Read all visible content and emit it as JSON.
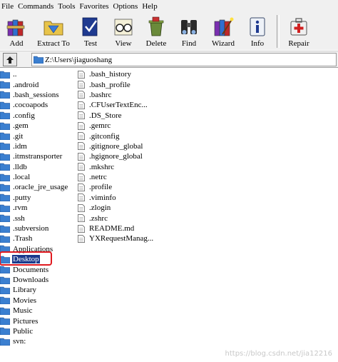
{
  "menu": [
    "File",
    "Commands",
    "Tools",
    "Favorites",
    "Options",
    "Help"
  ],
  "toolbar": [
    {
      "label": "Add",
      "icon": "add-books-icon"
    },
    {
      "label": "Extract To",
      "icon": "extract-folder-icon"
    },
    {
      "label": "Test",
      "icon": "test-check-icon"
    },
    {
      "label": "View",
      "icon": "view-glasses-icon"
    },
    {
      "label": "Delete",
      "icon": "delete-bin-icon"
    },
    {
      "label": "Find",
      "icon": "find-binoculars-icon"
    },
    {
      "label": "Wizard",
      "icon": "wizard-wand-icon"
    },
    {
      "label": "Info",
      "icon": "info-icon"
    },
    {
      "label": "Repair",
      "icon": "repair-kit-icon"
    }
  ],
  "address": {
    "path": "Z:\\Users\\jiaguoshang"
  },
  "folders": [
    "..",
    ".android",
    ".bash_sessions",
    ".cocoapods",
    ".config",
    ".gem",
    ".git",
    ".idm",
    ".itmstransporter",
    ".lldb",
    ".local",
    ".oracle_jre_usage",
    ".putty",
    ".rvm",
    ".ssh",
    ".subversion",
    ".Trash",
    "Applications",
    "Desktop",
    "Documents",
    "Downloads",
    "Library",
    "Movies",
    "Music",
    "Pictures",
    "Public",
    "svn:"
  ],
  "files": [
    ".bash_history",
    ".bash_profile",
    ".bashrc",
    ".CFUserTextEnc...",
    ".DS_Store",
    ".gemrc",
    ".gitconfig",
    ".gitignore_global",
    ".hgignore_global",
    ".mkshrc",
    ".netrc",
    ".profile",
    ".viminfo",
    ".zlogin",
    ".zshrc",
    "README.md",
    "YXRequestManag..."
  ],
  "selected": "Desktop",
  "watermark": "https://blog.csdn.net/jia12216",
  "colors": {
    "selection": "#1a3a8c",
    "highlight": "#e0191f",
    "folder": "#3b7fd0"
  }
}
